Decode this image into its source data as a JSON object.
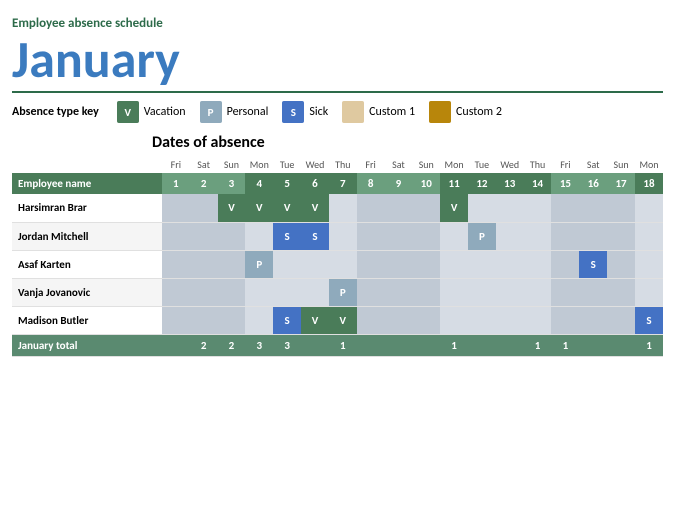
{
  "header": {
    "title": "Employee absence schedule",
    "month": "January"
  },
  "absence_key": {
    "label": "Absence type key",
    "items": [
      {
        "code": "V",
        "label": "Vacation",
        "class": "vacation"
      },
      {
        "code": "P",
        "label": "Personal",
        "class": "personal"
      },
      {
        "code": "S",
        "label": "Sick",
        "class": "sick"
      },
      {
        "code": "",
        "label": "Custom 1",
        "class": "custom1"
      },
      {
        "code": "",
        "label": "Custom 2",
        "class": "custom2"
      }
    ]
  },
  "dates_heading": "Dates of absence",
  "columns": {
    "day_of_weeks": [
      "",
      "Fri",
      "Sat",
      "Sun",
      "Mon",
      "Tue",
      "Wed",
      "Thu",
      "Fri",
      "Sat",
      "Sun",
      "Mon",
      "Tue",
      "Wed",
      "Thu",
      "Fri",
      "Sat",
      "Sun",
      "Mon"
    ],
    "dates": [
      "Employee name",
      "1",
      "2",
      "3",
      "4",
      "5",
      "6",
      "7",
      "8",
      "9",
      "10",
      "11",
      "12",
      "13",
      "14",
      "15",
      "16",
      "17",
      "18"
    ]
  },
  "employees": [
    {
      "name": "Harsimran Brar",
      "absences": {
        "3": "V",
        "4": "V",
        "5": "V",
        "6": "V",
        "11": "V"
      }
    },
    {
      "name": "Jordan Mitchell",
      "absences": {
        "5": "S",
        "6": "S",
        "12": "P"
      }
    },
    {
      "name": "Asaf Karten",
      "absences": {
        "4": "P",
        "16": "S"
      }
    },
    {
      "name": "Vanja Jovanovic",
      "absences": {
        "7": "P"
      }
    },
    {
      "name": "Madison Butler",
      "absences": {
        "5": "S",
        "6": "V",
        "7": "V",
        "18": "S"
      }
    }
  ],
  "totals": {
    "label": "January total",
    "values": {
      "2": "2",
      "3": "2",
      "4": "3",
      "5": "3",
      "7": "1",
      "11": "1",
      "14": "1",
      "15": "1",
      "18": "1"
    }
  }
}
